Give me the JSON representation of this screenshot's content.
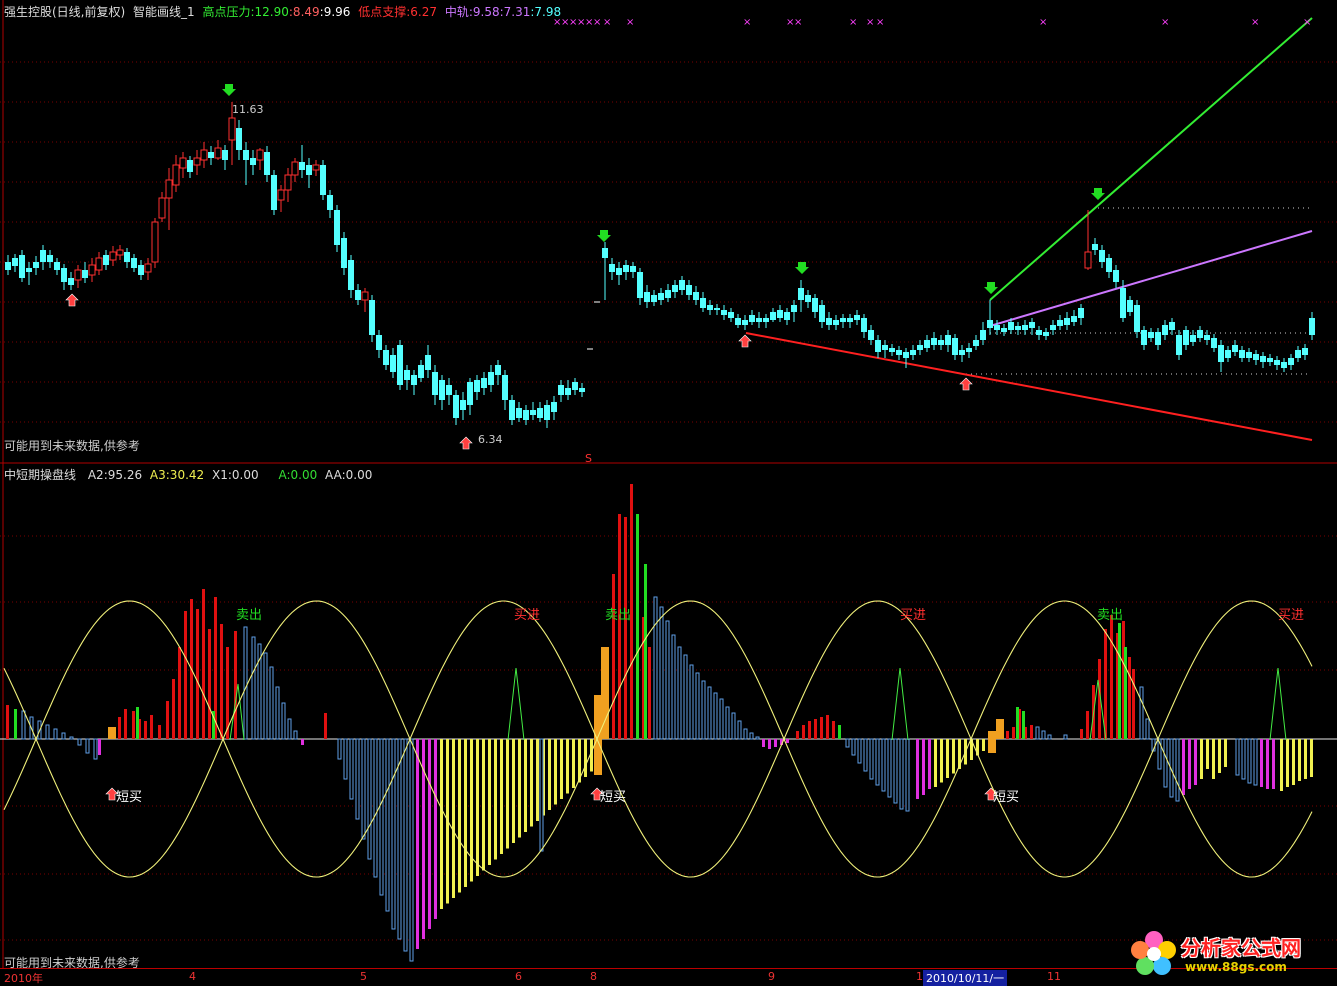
{
  "top_panel": {
    "stock_name": "强生控股(日线,前复权)",
    "indicator_name": "智能画线_1",
    "resistance_label": "高点压力:12.90",
    "resistance_v2": ":8.49",
    "resistance_v3": ":9.96",
    "support_label": "低点支撑:6.27",
    "mid_label": "中轨:9.58",
    "mid_v2": ":7.31",
    "mid_v3": ":7.98",
    "high_value": "11.63",
    "low_value": "6.34",
    "footnote": "可能用到未来数据,供参考"
  },
  "bottom_panel": {
    "indicator_name": "中短期操盘线",
    "a2_label": "A2:95.26",
    "a3_label": "A3:30.42",
    "x1_label": "X1:0.00",
    "a_label": "A:0.00",
    "aa_label": "AA:0.00",
    "footnote": "可能用到未来数据,供参考",
    "sell_label": "卖出",
    "buy_label": "买进",
    "short_buy_label": "短买"
  },
  "time_axis": {
    "year": "2010年",
    "m4": "4",
    "m5": "5",
    "m6": "6",
    "m8": "8",
    "m9": "9",
    "m10": "1",
    "current_date": "2010/10/11/一",
    "m11": "11"
  },
  "watermark": {
    "name": "分析家公式网",
    "url": "www.88gs.com"
  },
  "colors": {
    "up": "#ff3030",
    "down": "#54ffff",
    "resistance": "#33ee33",
    "support": "#ff2020",
    "mid": "#cc77ff",
    "sine": "#f0f07a",
    "bar_red": "#e01010",
    "bar_blue": "#5f9fe8",
    "bar_yellow": "#f0f050",
    "bar_magenta": "#e030e0",
    "bar_orange": "#f0a020",
    "bar_green": "#22dd22"
  },
  "chart_data": {
    "type": "candlestick",
    "title": "强生控股(日线,前复权)",
    "price_high": 11.63,
    "price_low": 6.34,
    "resistance": [
      12.9,
      8.49,
      9.96
    ],
    "support": 6.27,
    "mid_band": [
      9.58,
      7.31,
      7.98
    ],
    "oscillator": {
      "A2": 95.26,
      "A3": 30.42,
      "X1": 0,
      "A": 0,
      "AA": 0
    }
  }
}
